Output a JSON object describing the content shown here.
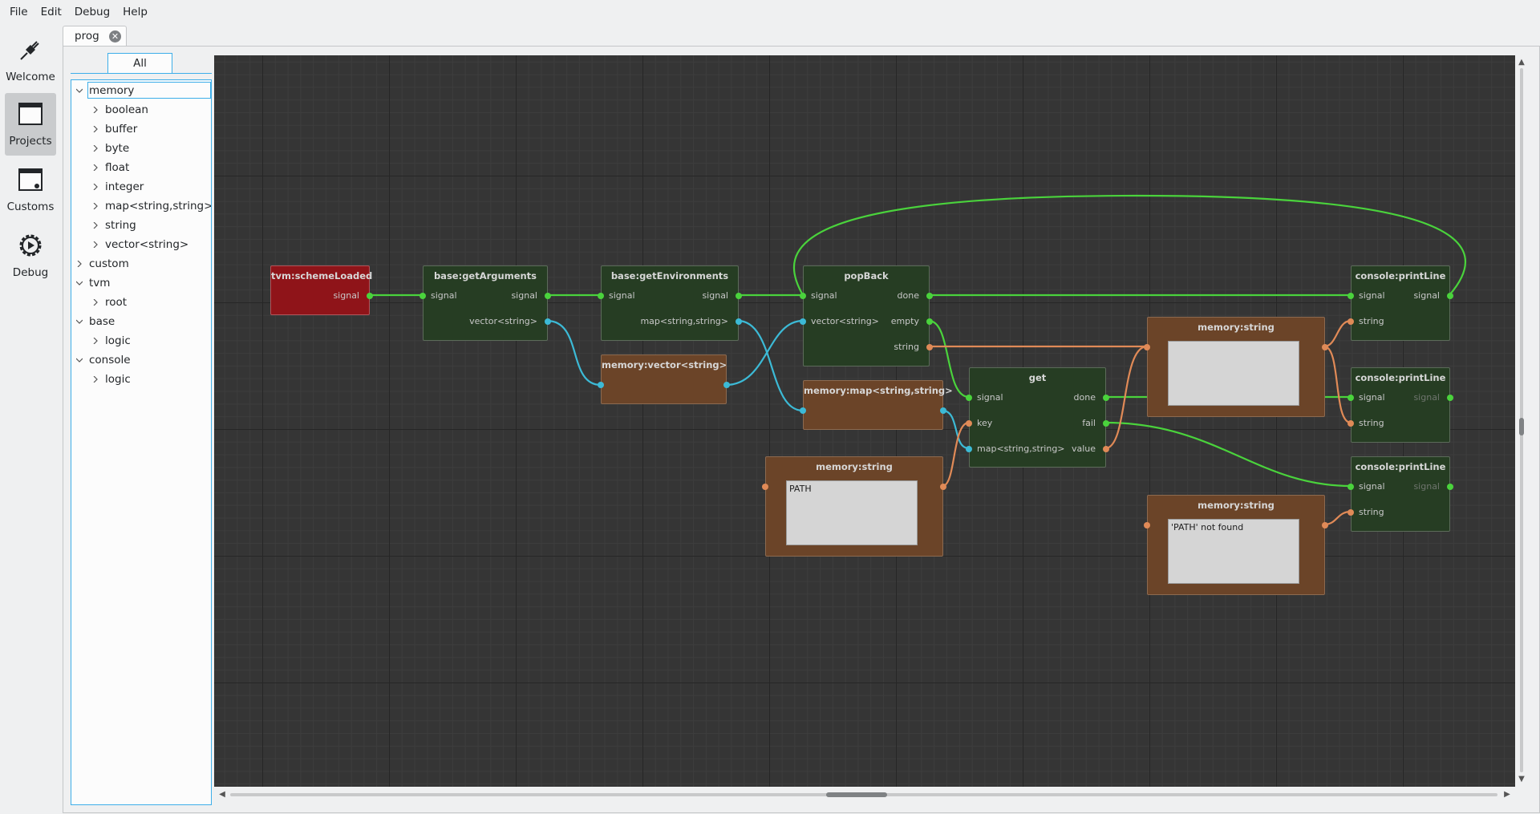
{
  "menu": [
    "File",
    "Edit",
    "Debug",
    "Help"
  ],
  "modes": [
    {
      "label": "Welcome",
      "icon": "plug-icon",
      "active": false
    },
    {
      "label": "Projects",
      "icon": "window-icon",
      "active": true
    },
    {
      "label": "Customs",
      "icon": "window-gear-icon",
      "active": false
    },
    {
      "label": "Debug",
      "icon": "gear-play-icon",
      "active": false
    }
  ],
  "tab": {
    "label": "prog"
  },
  "library": {
    "tab_label": "All",
    "tree": [
      {
        "label": "memory",
        "depth": 0,
        "expanded": true,
        "selected": true
      },
      {
        "label": "boolean",
        "depth": 1,
        "expanded": false
      },
      {
        "label": "buffer",
        "depth": 1,
        "expanded": false
      },
      {
        "label": "byte",
        "depth": 1,
        "expanded": false
      },
      {
        "label": "float",
        "depth": 1,
        "expanded": false
      },
      {
        "label": "integer",
        "depth": 1,
        "expanded": false
      },
      {
        "label": "map<string,string>",
        "depth": 1,
        "expanded": false
      },
      {
        "label": "string",
        "depth": 1,
        "expanded": false
      },
      {
        "label": "vector<string>",
        "depth": 1,
        "expanded": false
      },
      {
        "label": "custom",
        "depth": 0,
        "expanded": false
      },
      {
        "label": "tvm",
        "depth": 0,
        "expanded": true
      },
      {
        "label": "root",
        "depth": 1,
        "expanded": false
      },
      {
        "label": "base",
        "depth": 0,
        "expanded": true
      },
      {
        "label": "logic",
        "depth": 1,
        "expanded": false
      },
      {
        "label": "console",
        "depth": 0,
        "expanded": true
      },
      {
        "label": "logic",
        "depth": 1,
        "expanded": false
      }
    ]
  },
  "colors": {
    "signal": "#4ad33c",
    "string": "#e08a57",
    "container": "#3cbad6"
  },
  "nodes": {
    "schemeLoaded": {
      "title": "tvm:schemeLoaded",
      "out_signal": "signal"
    },
    "getArguments": {
      "title": "base:getArguments",
      "in_signal": "signal",
      "out_signal": "signal",
      "out_vector": "vector<string>"
    },
    "getEnvironments": {
      "title": "base:getEnvironments",
      "in_signal": "signal",
      "out_signal": "signal",
      "out_map": "map<string,string>"
    },
    "vectorString": {
      "title": "memory:vector<string>"
    },
    "popBack": {
      "title": "popBack",
      "in_signal": "signal",
      "in_vector": "vector<string>",
      "out_done": "done",
      "out_empty": "empty",
      "out_string": "string"
    },
    "mapString": {
      "title": "memory:map<string,string>"
    },
    "memPath": {
      "title": "memory:string",
      "value": "PATH"
    },
    "get": {
      "title": "get",
      "in_signal": "signal",
      "in_key": "key",
      "in_map": "map<string,string>",
      "out_done": "done",
      "out_fail": "fail",
      "out_value": "value"
    },
    "memEmpty": {
      "title": "memory:string",
      "value": ""
    },
    "memNotFound": {
      "title": "memory:string",
      "value": "'PATH' not found"
    },
    "print1": {
      "title": "console:printLine",
      "in_signal": "signal",
      "in_string": "string",
      "out_signal": "signal"
    },
    "print2": {
      "title": "console:printLine",
      "in_signal": "signal",
      "in_string": "string",
      "out_signal": "signal"
    },
    "print3": {
      "title": "console:printLine",
      "in_signal": "signal",
      "in_string": "string",
      "out_signal": "signal"
    }
  }
}
